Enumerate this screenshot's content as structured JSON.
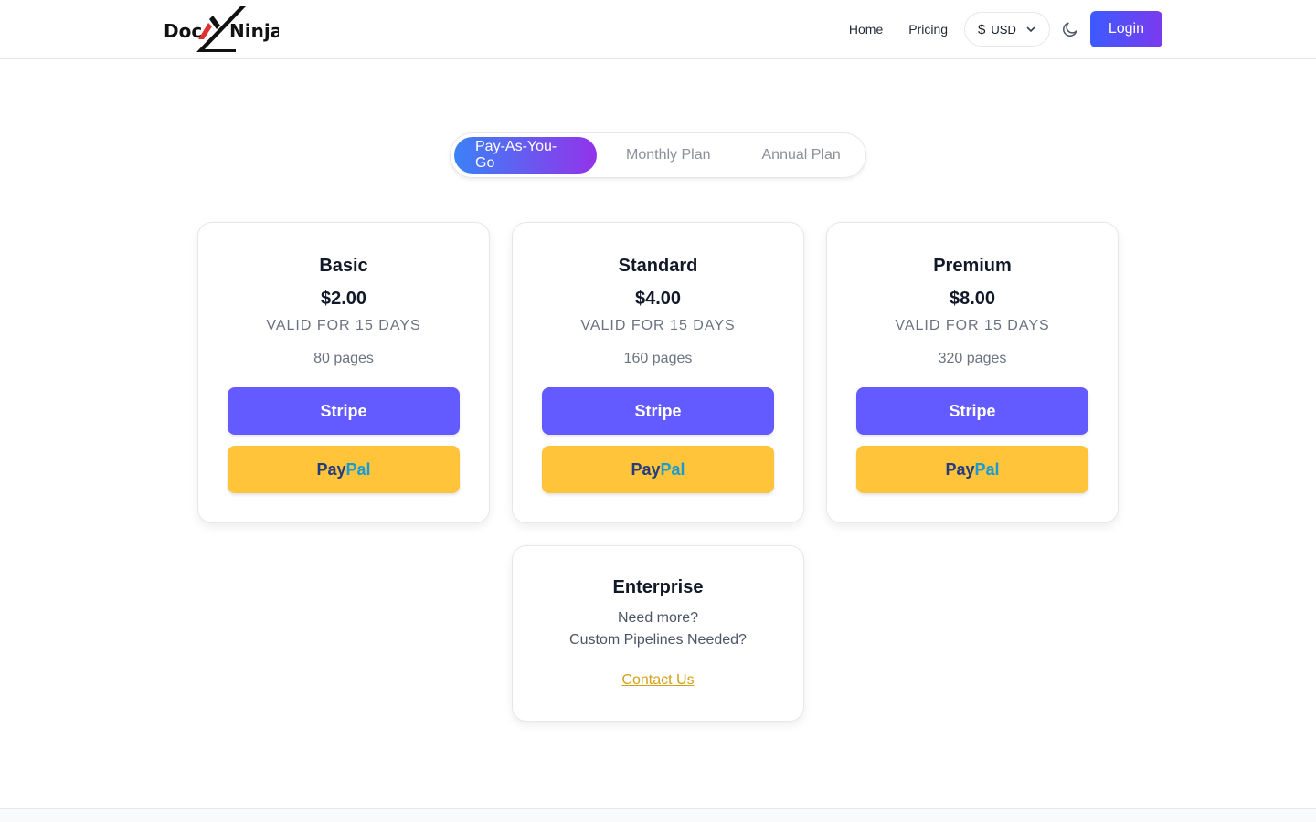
{
  "brand": {
    "left": "Doc",
    "right": "Ninja"
  },
  "nav": {
    "home": "Home",
    "pricing": "Pricing",
    "currency_symbol": "$",
    "currency": "USD",
    "login": "Login"
  },
  "tabs": [
    {
      "label": "Pay-As-You-Go",
      "active": true
    },
    {
      "label": "Monthly Plan",
      "active": false
    },
    {
      "label": "Annual Plan",
      "active": false
    }
  ],
  "plans": [
    {
      "name": "Basic",
      "price": "$2.00",
      "validity": "VALID FOR 15 DAYS",
      "pages": "80 pages",
      "stripe": "Stripe",
      "paypal_a": "Pay",
      "paypal_b": "Pal"
    },
    {
      "name": "Standard",
      "price": "$4.00",
      "validity": "VALID FOR 15 DAYS",
      "pages": "160 pages",
      "stripe": "Stripe",
      "paypal_a": "Pay",
      "paypal_b": "Pal"
    },
    {
      "name": "Premium",
      "price": "$8.00",
      "validity": "VALID FOR 15 DAYS",
      "pages": "320 pages",
      "stripe": "Stripe",
      "paypal_a": "Pay",
      "paypal_b": "Pal"
    }
  ],
  "enterprise": {
    "title": "Enterprise",
    "line1": "Need more?",
    "line2": "Custom Pipelines Needed?",
    "contact": "Contact Us"
  },
  "colors": {
    "accent_start": "#3b82f6",
    "accent_end": "#9333ea",
    "stripe": "#635bff",
    "paypal": "#ffc439",
    "contact_link": "#d4a017",
    "logo_red": "#e03131"
  }
}
